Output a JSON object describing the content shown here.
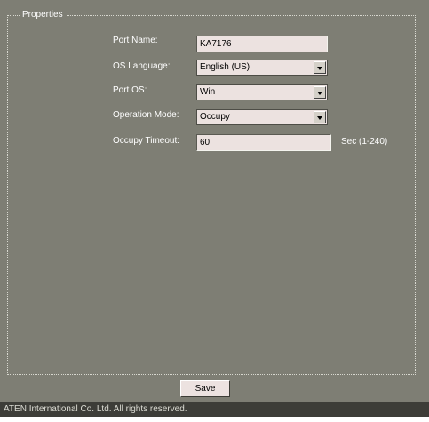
{
  "properties": {
    "legend": "Properties",
    "port_name": {
      "label": "Port Name:",
      "value": "KA7176"
    },
    "os_language": {
      "label": "OS Language:",
      "value": "English (US)"
    },
    "port_os": {
      "label": "Port OS:",
      "value": "Win"
    },
    "operation_mode": {
      "label": "Operation Mode:",
      "value": "Occupy"
    },
    "occupy_timeout": {
      "label": "Occupy Timeout:",
      "value": "60",
      "suffix": "Sec (1-240)"
    }
  },
  "actions": {
    "save_label": "Save"
  },
  "footer": {
    "copyright": "ATEN International Co. Ltd. All rights reserved."
  },
  "colors": {
    "panel_bg": "#7e7e74",
    "field_bg": "#ece2e0",
    "footer_bg": "#3d3d38"
  },
  "icons": {
    "dropdown": "chevron-down-icon"
  }
}
